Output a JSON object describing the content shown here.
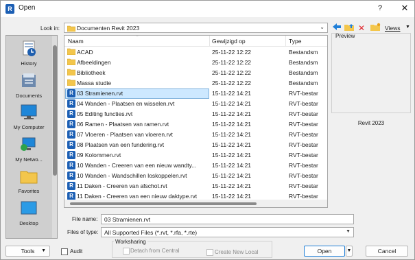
{
  "window": {
    "title": "Open",
    "help_label": "?",
    "close_label": "✕"
  },
  "places": [
    {
      "label": "History",
      "icon": "history-icon"
    },
    {
      "label": "Documents",
      "icon": "documents-icon"
    },
    {
      "label": "My Computer",
      "icon": "my-computer-icon"
    },
    {
      "label": "My Netwo...",
      "icon": "my-network-icon"
    },
    {
      "label": "Favorites",
      "icon": "favorites-icon"
    },
    {
      "label": "Desktop",
      "icon": "desktop-icon"
    }
  ],
  "look_in": {
    "label": "Look in:",
    "value": "Documenten Revit 2023"
  },
  "toolbar": {
    "views_label": "Views"
  },
  "columns": {
    "name": "Naam",
    "modified": "Gewijzigd op",
    "type": "Type"
  },
  "files": [
    {
      "name": "ACAD",
      "date": "25-11-22 12:22",
      "type": "Bestandsm",
      "kind": "folder"
    },
    {
      "name": "Afbeeldingen",
      "date": "25-11-22 12:22",
      "type": "Bestandsm",
      "kind": "folder"
    },
    {
      "name": "Bibliotheek",
      "date": "25-11-22 12:22",
      "type": "Bestandsm",
      "kind": "folder"
    },
    {
      "name": "Massa studie",
      "date": "25-11-22 12:22",
      "type": "Bestandsm",
      "kind": "folder"
    },
    {
      "name": "03 Stramienen.rvt",
      "date": "15-11-22 14:21",
      "type": "RVT-bestar",
      "kind": "rvt",
      "selected": true
    },
    {
      "name": "04 Wanden - Plaatsen en wisselen.rvt",
      "date": "15-11-22 14:21",
      "type": "RVT-bestar",
      "kind": "rvt"
    },
    {
      "name": "05 Editing functies.rvt",
      "date": "15-11-22 14:21",
      "type": "RVT-bestar",
      "kind": "rvt"
    },
    {
      "name": "06 Ramen - Plaatsen van ramen.rvt",
      "date": "15-11-22 14:21",
      "type": "RVT-bestar",
      "kind": "rvt"
    },
    {
      "name": "07 Vloeren - Plaatsen van vloeren.rvt",
      "date": "15-11-22 14:21",
      "type": "RVT-bestar",
      "kind": "rvt"
    },
    {
      "name": "08 Plaatsen van een fundering.rvt",
      "date": "15-11-22 14:21",
      "type": "RVT-bestar",
      "kind": "rvt"
    },
    {
      "name": "09 Kolommen.rvt",
      "date": "15-11-22 14:21",
      "type": "RVT-bestar",
      "kind": "rvt"
    },
    {
      "name": "10 Wanden - Creeren van een nieuw wandty...",
      "date": "15-11-22 14:21",
      "type": "RVT-bestar",
      "kind": "rvt"
    },
    {
      "name": "10 Wanden - Wandschillen loskoppelen.rvt",
      "date": "15-11-22 14:21",
      "type": "RVT-bestar",
      "kind": "rvt"
    },
    {
      "name": "11 Daken - Creeren van afschot.rvt",
      "date": "15-11-22 14:21",
      "type": "RVT-bestar",
      "kind": "rvt"
    },
    {
      "name": "11 Daken - Creeren van een nieuw daktype.rvt",
      "date": "15-11-22 14:21",
      "type": "RVT-bestar",
      "kind": "rvt"
    }
  ],
  "preview": {
    "title": "Preview",
    "caption": "Revit 2023"
  },
  "file_name": {
    "label": "File name:",
    "value": "03 Stramienen.rvt"
  },
  "file_type": {
    "label": "Files of type:",
    "value": "All Supported Files (*.rvt, *.rfa, *.rte)"
  },
  "bottom": {
    "tools_label": "Tools",
    "audit_label": "Audit",
    "worksharing_title": "Worksharing",
    "detach_label": "Detach from Central",
    "create_local_label": "Create New Local",
    "open_label": "Open",
    "cancel_label": "Cancel"
  },
  "colors": {
    "accent": "#1c5fb4",
    "selection": "#cde8ff",
    "folder": "#f3c64c"
  }
}
